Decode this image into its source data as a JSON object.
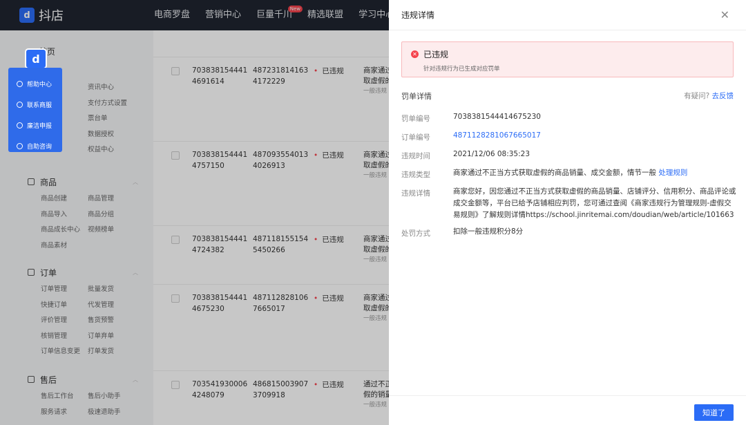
{
  "topnav": {
    "brand": "抖店",
    "items": [
      {
        "label": "电商罗盘"
      },
      {
        "label": "营销中心"
      },
      {
        "label": "巨量千川",
        "badge": "New"
      },
      {
        "label": "精选联盟"
      },
      {
        "label": "学习中心"
      }
    ]
  },
  "sidebar": {
    "home": "首页",
    "top_links": [
      "资讯中心",
      "支付方式设置",
      "",
      "票台单",
      "",
      "数据授权",
      "",
      "权益中心"
    ],
    "sections": [
      {
        "title": "商品",
        "links": [
          "商品创建",
          "商品管理",
          "商品导入",
          "商品分组",
          "商品成长中心",
          "视频榜单",
          "商品素材",
          ""
        ]
      },
      {
        "title": "订单",
        "links": [
          "订单管理",
          "批量发货",
          "快捷订单",
          "代发管理",
          "评价管理",
          "售货预警",
          "核销管理",
          "订单弃单",
          "订单信息变更",
          "打单发货"
        ]
      },
      {
        "title": "售后",
        "links": [
          "售后工作台",
          "售后小助手",
          "服务请求",
          "极速退助手"
        ]
      }
    ]
  },
  "help_panel": {
    "items": [
      "帮助中心",
      "联系商服",
      "廉洁申报",
      "自助咨询"
    ]
  },
  "table": {
    "rows": [
      {
        "id_a": "703838154441",
        "id_b": "4691614",
        "order_a": "487231814163",
        "order_b": "4172229",
        "status": "已违规",
        "desc_a": "商家通过",
        "desc_b": "取虚假的",
        "desc_c": "一般违规"
      },
      {
        "id_a": "703838154441",
        "id_b": "4757150",
        "order_a": "487093554013",
        "order_b": "4026913",
        "status": "已违规",
        "desc_a": "商家通过",
        "desc_b": "取虚假的",
        "desc_c": "一般违规"
      },
      {
        "id_a": "703838154441",
        "id_b": "4724382",
        "order_a": "487118155154",
        "order_b": "5450266",
        "status": "已违规",
        "desc_a": "商家通过",
        "desc_b": "取虚假的",
        "desc_c": "一般违规"
      },
      {
        "id_a": "703838154441",
        "id_b": "4675230",
        "order_a": "487112828106",
        "order_b": "7665017",
        "status": "已违规",
        "desc_a": "商家通过",
        "desc_b": "取虚假的",
        "desc_c": "一般违规"
      },
      {
        "id_a": "703541930006",
        "id_b": "4248079",
        "order_a": "486815003907",
        "order_b": "3709918",
        "status": "已违规",
        "desc_a": "通过不正",
        "desc_b": "假的销量",
        "desc_c": "一般违规"
      }
    ]
  },
  "drawer": {
    "title": "违规详情",
    "alert_title": "已违规",
    "alert_sub": "针对违规行为已生成对应罚单",
    "section_title": "罚单详情",
    "feedback_q": "有疑问?",
    "feedback_link": "去反馈",
    "fields": {
      "penalty_no_label": "罚单编号",
      "penalty_no": "7038381544414675230",
      "order_no_label": "订单编号",
      "order_no": "4871128281067665017",
      "time_label": "违规时间",
      "time": "2021/12/06 08:35:23",
      "type_label": "违规类型",
      "type": "商家通过不正当方式获取虚假的商品销量、成交金额，情节一般",
      "type_link": "处理规则",
      "detail_label": "违规详情",
      "detail": "商家您好，因您通过不正当方式获取虚假的商品销量、店铺评分、信用积分、商品评论或成交金额等，平台已给予店铺相应判罚，您可通过查阅《商家违规行为管理规则-虚假交易规则》了解规则详情https://school.jinritemai.com/doudian/web/article/101663",
      "method_label": "处罚方式",
      "method": "扣除一般违规积分8分"
    },
    "ok_label": "知道了"
  }
}
